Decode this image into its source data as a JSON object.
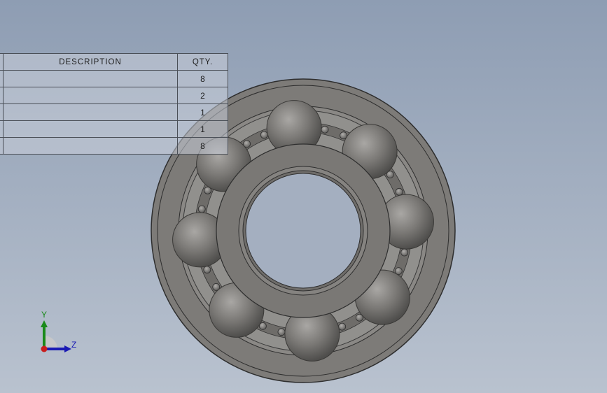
{
  "bom": {
    "headers": {
      "description": "DESCRIPTION",
      "qty": "QTY."
    },
    "rows": [
      {
        "description": "",
        "qty": "8"
      },
      {
        "description": "",
        "qty": "2"
      },
      {
        "description": "",
        "qty": "1"
      },
      {
        "description": "",
        "qty": "1"
      },
      {
        "description": "",
        "qty": "8"
      }
    ]
  },
  "triad": {
    "y_label": "Y",
    "z_label": "Z"
  },
  "colors": {
    "background_top": "#8e9db3",
    "background_bottom": "#b9c2cf",
    "part_gray": "#7a7875",
    "axis_y": "#1a8a1a",
    "axis_z": "#1a1ab4",
    "axis_x": "#c81e1e"
  },
  "model": {
    "type": "ball-bearing",
    "ball_count": 8
  }
}
